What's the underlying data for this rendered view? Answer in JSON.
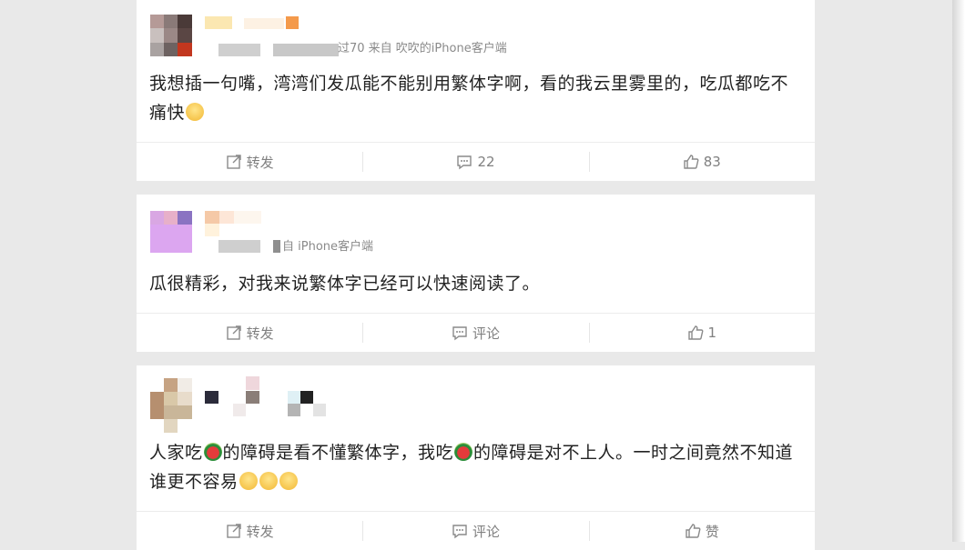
{
  "feed": {
    "posts": [
      {
        "source": "过70 来自 吹吹的iPhone客户端",
        "text": "我想插一句嘴，湾湾们发瓜能不能别用繁体字啊，看的我云里雾里的，吃瓜都吃不痛快",
        "emojis": [
          "smile-face"
        ],
        "actions": {
          "repost": "转发",
          "comment": "22",
          "like": "83"
        }
      },
      {
        "source": "自 iPhone客户端",
        "text": "瓜很精彩，对我来说繁体字已经可以快速阅读了。",
        "actions": {
          "repost": "转发",
          "comment": "评论",
          "like": "1"
        }
      },
      {
        "text_a": "人家吃",
        "text_b": "的障碍是看不懂繁体字，我吃",
        "text_c": "的障碍是对不上人。一时之间竟然不知道谁更不容易",
        "emojis": [
          "watermelon",
          "watermelon",
          "cry-face",
          "cry-face",
          "cry-face"
        ],
        "actions": {
          "repost": "转发",
          "comment": "评论",
          "like": "赞"
        }
      }
    ]
  },
  "colors": {
    "text": "#222222",
    "meta": "#8a8a8a",
    "action": "#808080",
    "background": "#e9e9e9"
  }
}
